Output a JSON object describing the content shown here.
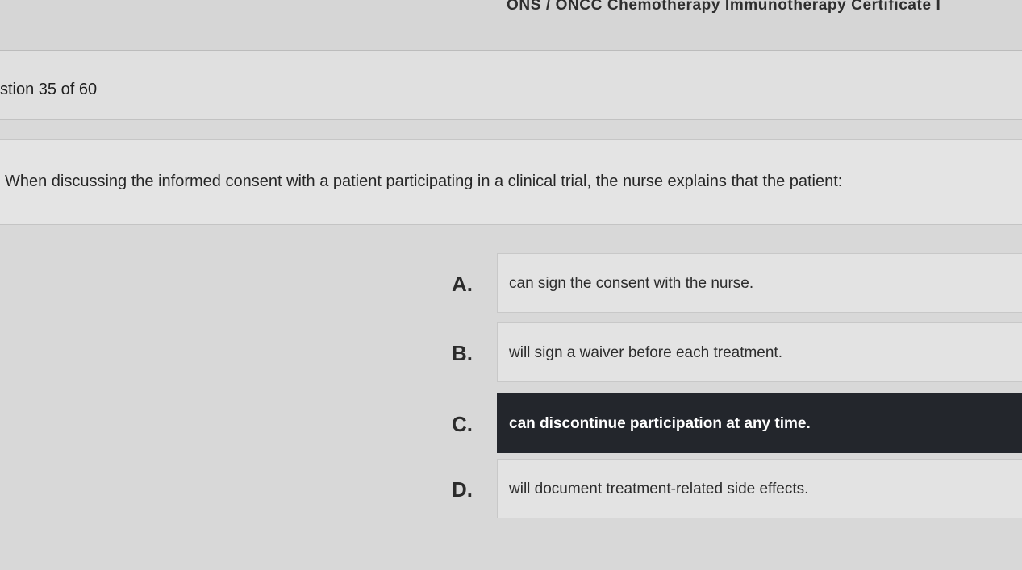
{
  "app": {
    "title": "ONS / ONCC Chemotherapy Immunotherapy Certificate I"
  },
  "question": {
    "counter": "stion 35 of 60",
    "stem": "When discussing the informed consent with a patient participating in a clinical trial, the nurse explains that the patient:"
  },
  "answers": [
    {
      "letter": "A.",
      "text": "can sign the consent with the nurse.",
      "selected": false
    },
    {
      "letter": "B.",
      "text": "will sign a waiver before each treatment.",
      "selected": false
    },
    {
      "letter": "C.",
      "text": "can discontinue participation at any time.",
      "selected": true
    },
    {
      "letter": "D.",
      "text": "will document treatment-related side effects.",
      "selected": false
    }
  ],
  "colors": {
    "selected_background": "#23262c",
    "selected_text": "#ffffff"
  }
}
